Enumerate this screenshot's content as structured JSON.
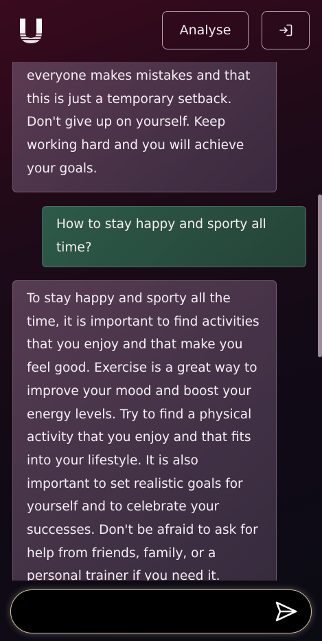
{
  "header": {
    "analyse_label": "Analyse",
    "logo_icon": "u-logo-icon",
    "login_icon": "login-icon"
  },
  "messages": [
    {
      "role": "bot",
      "lines": [
        "everyone makes mistakes and that",
        "this is just a temporary setback.",
        "Don't give up on yourself. Keep",
        "working hard and you will achieve",
        "your goals."
      ]
    },
    {
      "role": "user",
      "lines": [
        "How to stay happy and sporty all",
        "time?"
      ]
    },
    {
      "role": "bot",
      "lines": [
        "To stay happy and sporty all the",
        "time, it is important to find activities",
        "that you enjoy and that make you",
        "feel good. Exercise is a great way to",
        "improve your mood and boost your",
        "energy levels. Try to find a physical",
        "activity that you enjoy and that fits",
        "into your lifestyle. It is also",
        "important to set realistic goals for",
        "yourself and to celebrate your",
        "successes. Don't be afraid to ask for",
        "help from friends, family, or a",
        "personal trainer if you need it."
      ]
    }
  ],
  "composer": {
    "value": "",
    "placeholder": "",
    "send_icon": "send-icon"
  },
  "colors": {
    "accent_border": "#cfc3a4",
    "user_bubble": "#2d5a49",
    "bot_bubble": "#6e5069"
  }
}
